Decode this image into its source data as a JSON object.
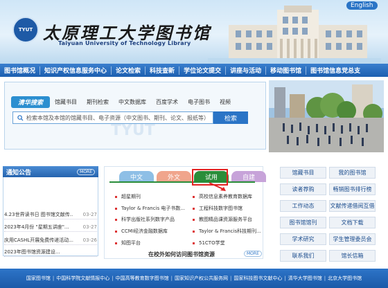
{
  "header": {
    "badge": "TYUT",
    "title_cn": "太原理工大学图书馆",
    "title_en": "Taiyuan University of Technology Library",
    "lang_link": "English"
  },
  "nav": {
    "items": [
      "图书馆概况",
      "知识产权信息服务中心",
      "论文检索",
      "科技查新",
      "学位论文提交",
      "讲座与活动",
      "移动图书馆",
      "图书馆信息党总支"
    ]
  },
  "search": {
    "tabs": [
      "清华搜索",
      "馆藏书目",
      "期刊检索",
      "中文数据库",
      "百度学术",
      "电子图书",
      "视频"
    ],
    "placeholder": "检索本馆及本馆的馆藏书目、电子资源（中文图书、期刊、论文、报纸等）",
    "button": "检索"
  },
  "notice": {
    "title": "通知公告",
    "more": "MORE",
    "items": [
      {
        "text": "4.23世界读书日 图书馆文献传...",
        "date": "03-27"
      },
      {
        "text": "2023年4月份 \"星期五讲座\"...",
        "date": "03-27"
      },
      {
        "text": "庆用CASHL开展免费传递活动...",
        "date": "03-26"
      },
      {
        "text": "2023年图书馆资源建设...",
        "date": ""
      }
    ]
  },
  "resources": {
    "tabs": [
      "中文",
      "外文",
      "试用",
      "自建"
    ],
    "left_col": [
      "超星期刊",
      "Taylor & Francis 电子书数...",
      "科学出版社系列数字产品",
      "CCMI经济金融数据库",
      "知图平台"
    ],
    "right_col": [
      "高校信息素养教育数据库",
      "工程科技数字图书馆",
      "教图精品课资源服务平台",
      "Taylor & Francis科技期刊...",
      "51CTO学堂"
    ],
    "footer": "在校外如何访问图书馆资源",
    "more": "MORE"
  },
  "quick_links": [
    [
      "馆藏书目",
      "我的图书馆"
    ],
    [
      "读者荐购",
      "畅销图书排行榜"
    ],
    [
      "工作动态",
      "文献传递借阅互借"
    ],
    [
      "图书馆馆刊",
      "文档下载"
    ],
    [
      "学术研究",
      "学生管理委员会"
    ],
    [
      "联系我们",
      "馆长信箱"
    ]
  ],
  "footer": {
    "links": [
      "国家图书馆",
      "中国科学院文献情报中心",
      "中国高等教育数字图书馆",
      "国家知识产权公共服务网",
      "国家科技图书文献中心",
      "清华大学图书馆",
      "北京大学图书馆"
    ]
  },
  "colors": {
    "primary": "#1c5fb0",
    "accent_green": "#2a8d3a",
    "highlight_red": "#e32222"
  }
}
